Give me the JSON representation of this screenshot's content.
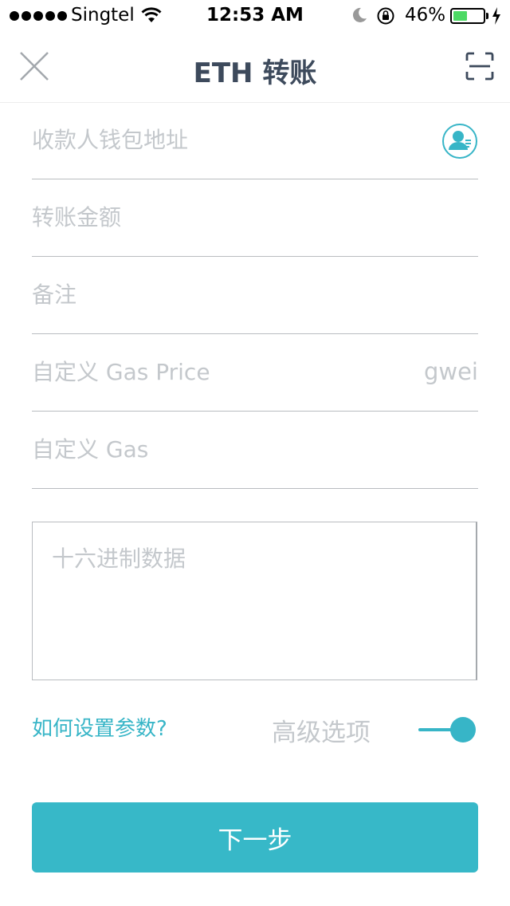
{
  "status_bar": {
    "carrier": "Singtel",
    "time": "12:53 AM",
    "battery_percent": "46%",
    "battery_level": 0.46,
    "signal_bars": 5
  },
  "header": {
    "title": "ETH 转账",
    "close_icon": "close-icon",
    "scan_icon": "scan-qr-icon"
  },
  "form": {
    "recipient_address": {
      "placeholder": "收款人钱包地址",
      "value": ""
    },
    "amount": {
      "placeholder": "转账金额",
      "value": ""
    },
    "memo": {
      "placeholder": "备注",
      "value": ""
    },
    "gas_price": {
      "placeholder": "自定义 Gas Price",
      "unit": "gwei",
      "value": ""
    },
    "gas": {
      "placeholder": "自定义 Gas",
      "value": ""
    },
    "hex_data": {
      "placeholder": "十六进制数据",
      "value": ""
    }
  },
  "advanced": {
    "help_link": "如何设置参数?",
    "label": "高级选项",
    "enabled": true
  },
  "next_button_label": "下一步",
  "colors": {
    "accent": "#37b5c7",
    "button": "#37b8c8",
    "title": "#3d4a5c",
    "placeholder": "#c4c8cc",
    "divider": "#b9bcc0",
    "battery": "#4cd964"
  }
}
